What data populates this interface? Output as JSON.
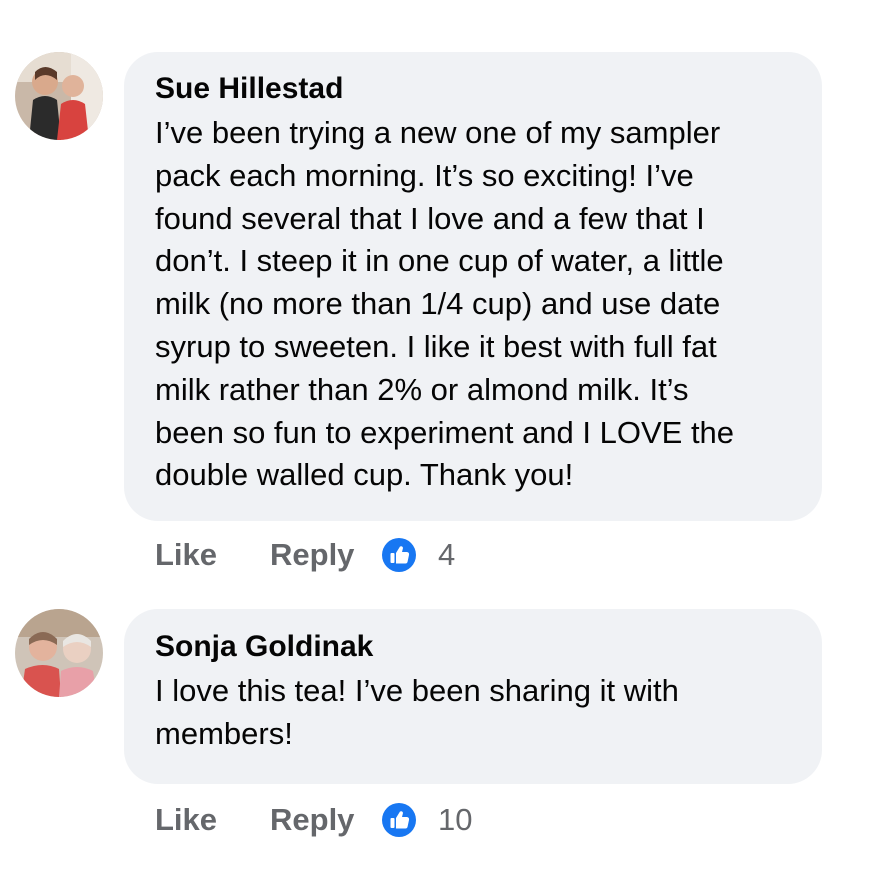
{
  "colors": {
    "bubble": "#f0f2f5",
    "text": "#050505",
    "secondary": "#65676b",
    "like_blue": "#1877f2"
  },
  "comments": [
    {
      "author": "Sue Hillestad",
      "lines": [
        "I’ve been trying a new one of my sampler",
        "pack each morning. It’s  so exciting! I’ve",
        "found several that I love and a few that I",
        "don’t. I steep it in one cup of water, a little",
        "milk (no more than 1/4 cup) and use date",
        "syrup to sweeten. I like it best with full fat",
        "milk rather than 2% or almond milk. It’s",
        "been so fun to experiment and I LOVE the",
        "double walled cup. Thank you!"
      ],
      "like_label": "Like",
      "reply_label": "Reply",
      "reaction_icon": "thumbs-up-icon",
      "reaction_count": "4"
    },
    {
      "author": "Sonja Goldinak",
      "lines": [
        "I love this tea! I’ve been sharing it with",
        "members!"
      ],
      "like_label": "Like",
      "reply_label": "Reply",
      "reaction_icon": "thumbs-up-icon",
      "reaction_count": "10"
    }
  ]
}
